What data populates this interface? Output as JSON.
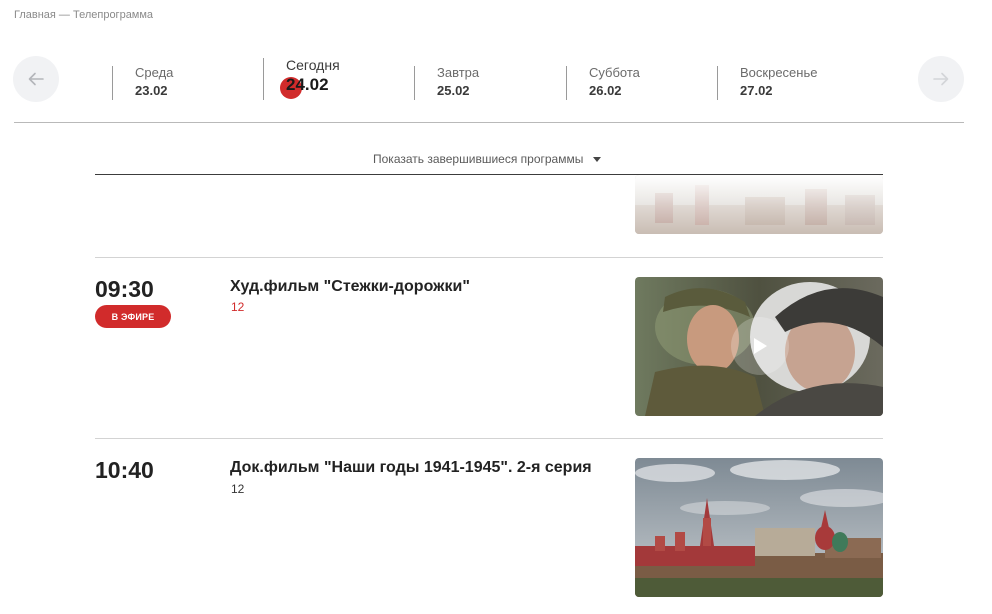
{
  "breadcrumb": "Главная — Телепрограмма",
  "days": [
    {
      "name": "Среда",
      "date": "23.02"
    },
    {
      "name": "Сегодня",
      "date": "24.02"
    },
    {
      "name": "Завтра",
      "date": "25.02"
    },
    {
      "name": "Суббота",
      "date": "26.02"
    },
    {
      "name": "Воскресенье",
      "date": "27.02"
    }
  ],
  "show_finished": "Показать завершившиеся программы",
  "programs": [
    {
      "time": "09:30",
      "title": "Худ.фильм \"Стежки-дорожки\"",
      "age": "12",
      "badge": "В ЭФИРЕ"
    },
    {
      "time": "10:40",
      "title": "Док.фильм \"Наши годы 1941-1945\". 2-я серия",
      "age": "12"
    }
  ],
  "colors": {
    "accent": "#d12b2b",
    "nav_bg": "#f1f2f4"
  },
  "icons": {
    "prev": "arrow-left-icon",
    "next": "arrow-right-icon",
    "play": "play-icon",
    "toggle": "caret-down-icon"
  }
}
